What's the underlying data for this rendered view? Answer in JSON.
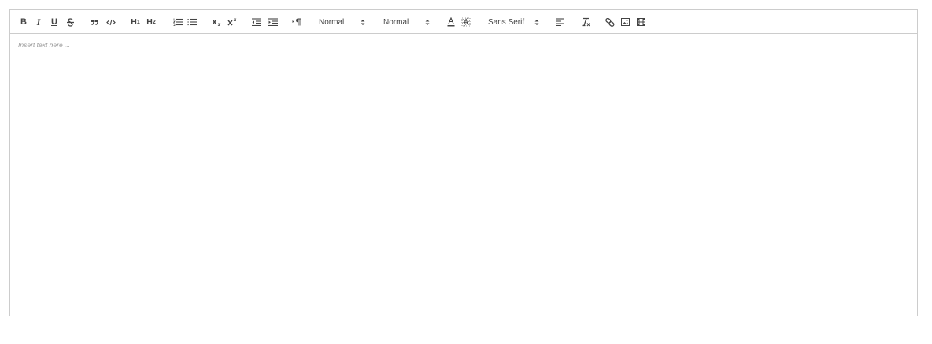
{
  "toolbar": {
    "bold": "B",
    "italic": "I",
    "underline": "U",
    "h1": "H",
    "h1_sub": "1",
    "h2": "H",
    "h2_sub": "2",
    "size_picker": "Normal",
    "header_picker": "Normal",
    "font_picker": "Sans Serif",
    "icons": [
      "strike-icon",
      "blockquote-icon",
      "code-block-icon",
      "ordered-list-icon",
      "bullet-list-icon",
      "subscript-icon",
      "superscript-icon",
      "outdent-icon",
      "indent-icon",
      "text-direction-icon",
      "font-color-icon",
      "background-color-icon",
      "align-icon",
      "clean-format-icon",
      "link-icon",
      "image-icon",
      "video-icon"
    ]
  },
  "editor": {
    "placeholder": "Insert text here ..."
  },
  "colors": {
    "border": "#cccccc",
    "icon": "#444444",
    "placeholder": "#999999"
  }
}
